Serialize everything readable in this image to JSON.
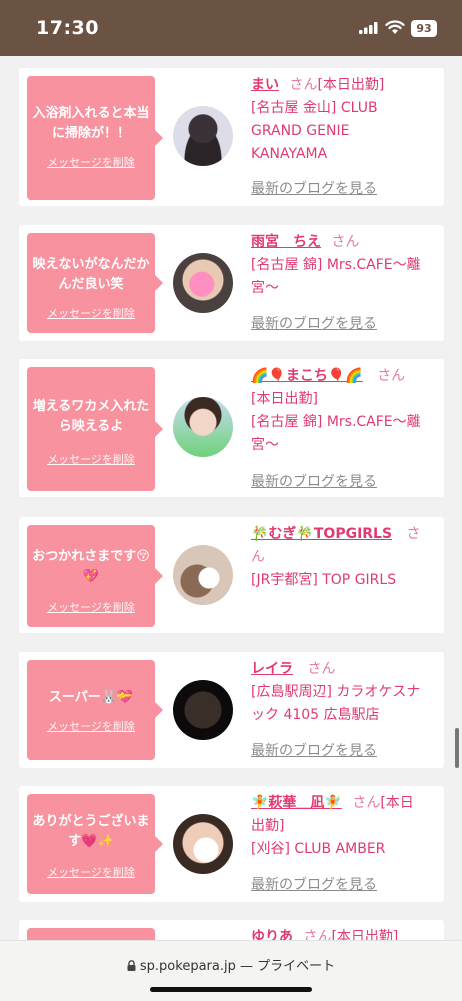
{
  "status_bar": {
    "time": "17:30",
    "battery": "93"
  },
  "messages": [
    {
      "bubble": "入浴剤入れると本当に掃除が！！",
      "delete": "メッセージを削除",
      "name": "まい",
      "suffix": "さん",
      "extra": "[本日出勤]",
      "lines": [
        "[名古屋 金山] CLUB",
        "GRAND GENIE",
        "KANAYAMA"
      ],
      "blog": "最新のブログを見る"
    },
    {
      "bubble": "映えないがなんだかんだ良い笑",
      "delete": "メッセージを削除",
      "name": "雨宮　ちえ",
      "suffix": "さん",
      "extra": "",
      "lines": [
        "[名古屋 錦] Mrs.CAFE〜離",
        "宮〜"
      ],
      "blog": "最新のブログを見る"
    },
    {
      "bubble": "増えるワカメ入れたら映えるよ",
      "delete": "メッセージを削除",
      "name": "🌈🎈まこち🎈🌈",
      "suffix": "さん",
      "extra": "",
      "lines": [
        "[本日出勤]",
        "[名古屋 錦] Mrs.CAFE〜離",
        "宮〜"
      ],
      "blog": "最新のブログを見る"
    },
    {
      "bubble": "おつかれさまです😚💖",
      "delete": "メッセージを削除",
      "name": "🎋むぎ🎋TOPGIRLS",
      "suffix": "さ",
      "extra": "",
      "lines": [
        "ん",
        "[JR宇都宮] TOP GIRLS"
      ],
      "blog": ""
    },
    {
      "bubble": "スーパー🐰💝",
      "delete": "メッセージを削除",
      "name": "レイラ",
      "suffix": "さん",
      "extra": "",
      "lines": [
        "[広島駅周辺] カラオケスナ",
        "ック 4105 広島駅店"
      ],
      "blog": "最新のブログを見る"
    },
    {
      "bubble": "ありがとうございます💗✨",
      "delete": "メッセージを削除",
      "name": "🧚萩華＿凪🧚",
      "suffix": "さん",
      "extra": "[本日",
      "lines": [
        "出勤]",
        "[刈谷] CLUB AMBER"
      ],
      "blog": "最新のブログを見る"
    },
    {
      "bubble": "",
      "delete": "",
      "name": "ゆりあ",
      "suffix": "さん",
      "extra": "[本日出勤]",
      "lines": [],
      "blog": ""
    }
  ],
  "url_bar": {
    "text": "sp.pokepara.jp — プライベート"
  },
  "colors": {
    "status_bg": "#6b5344",
    "bubble": "#f7929e",
    "name": "#e03a6f",
    "link": "#8c8c8c",
    "page_bg": "#f1f1f1"
  },
  "icons": [
    "signal-icon",
    "wifi-icon",
    "battery-icon",
    "lock-icon"
  ]
}
